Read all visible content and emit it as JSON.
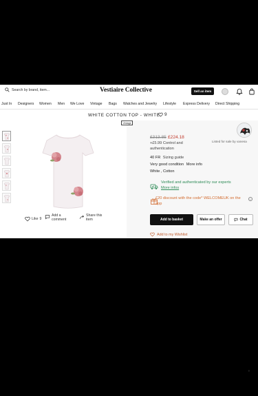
{
  "header": {
    "search_placeholder": "Search by brand, item...",
    "logo": "Vestiaire Collective",
    "sell_label": "Sell an item",
    "icons": [
      "search-icon",
      "user-avatar",
      "bell-icon",
      "bag-icon"
    ]
  },
  "nav": {
    "items": [
      {
        "label": "Just In"
      },
      {
        "label": "Designers"
      },
      {
        "label": "Women"
      },
      {
        "label": "Men"
      },
      {
        "label": "We Love"
      },
      {
        "label": "Vintage"
      },
      {
        "label": "Bags"
      },
      {
        "label": "Watches and Jewelry"
      },
      {
        "label": "Lifestyle"
      },
      {
        "label": "Express Delivery"
      },
      {
        "label": "Direct Shipping"
      }
    ]
  },
  "product": {
    "title": "WHITE COTTON TOP - WHITE",
    "likes": "9",
    "tag": "Vintage",
    "price_old": "£313.85",
    "price_new": "£224.18",
    "shipping_line1": "+£5.99 Control and",
    "shipping_line2": "authentication",
    "size": "40 FR",
    "size_guide": "Sizing guide",
    "condition": "Very good condition",
    "more_info": "More info",
    "material": "White , Cotton",
    "verified_line1": "Verified and authenticated by our experts",
    "verified_link": "More infos",
    "discount_line1": "£20 discount with the code* WELCOMEUK on the",
    "discount_line2": "app",
    "seller_text": "Listed for sale by vanesa"
  },
  "actions": {
    "like": "Like",
    "like_count": "9",
    "comment_line1": "Add a",
    "comment_line2": "comment",
    "share_line1": "Share this",
    "share_line2": "item"
  },
  "buttons": {
    "basket": "Add to basket",
    "offer": "Make an offer",
    "chat": "Chat",
    "wishlist": "Add to my Wishlist"
  },
  "colors": {
    "accent_red": "#c0392b",
    "verified_green": "#2e8b57",
    "promo_orange": "#d26a2d",
    "button_black": "#111111"
  },
  "misc": {
    "corner_mark": "ᵍ"
  }
}
